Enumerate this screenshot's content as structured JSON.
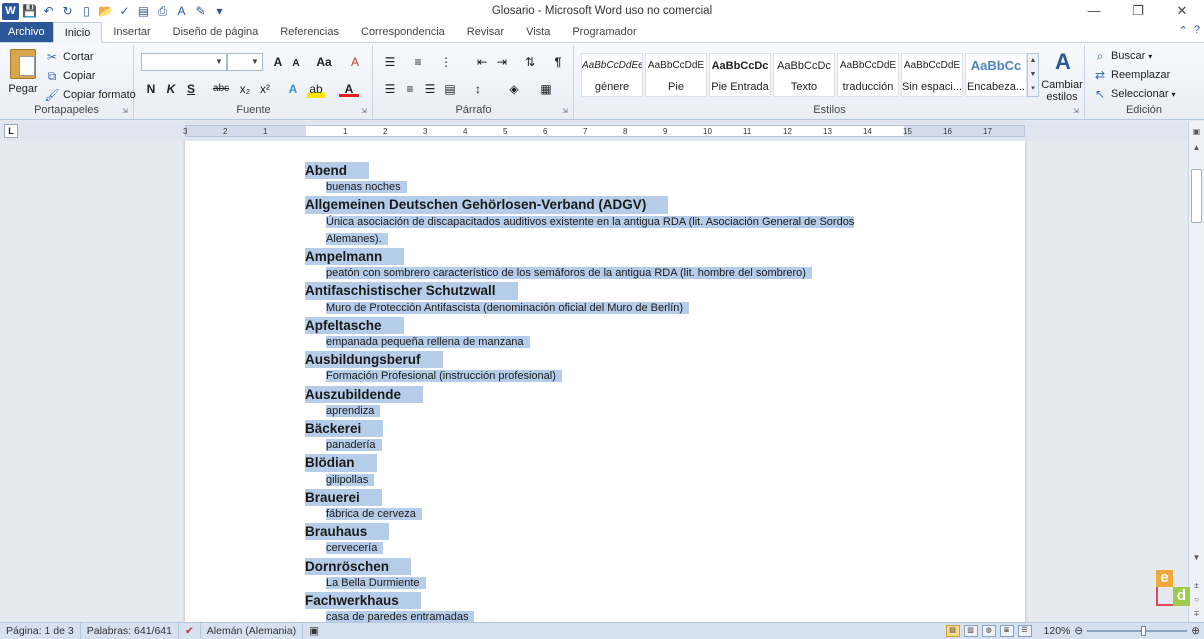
{
  "window": {
    "title": "Glosario  -  Microsoft Word uso no comercial",
    "app_icon_label": "W",
    "controls": [
      "—",
      "❐",
      "✕"
    ]
  },
  "qat": {
    "icons": [
      "save-icon",
      "undo-icon",
      "redo-icon",
      "new-icon",
      "open-icon",
      "spelling-icon",
      "print-preview-icon",
      "quick-print-icon",
      "font-color-icon",
      "track-icon",
      "customize-icon"
    ]
  },
  "tabs": [
    {
      "label": "Archivo",
      "kind": "file"
    },
    {
      "label": "Inicio",
      "kind": "active"
    },
    {
      "label": "Insertar"
    },
    {
      "label": "Diseño de página"
    },
    {
      "label": "Referencias"
    },
    {
      "label": "Correspondencia"
    },
    {
      "label": "Revisar"
    },
    {
      "label": "Vista"
    },
    {
      "label": "Programador"
    }
  ],
  "ribbon": {
    "clipboard": {
      "label": "Portapapeles",
      "paste": "Pegar",
      "cut": "Cortar",
      "copy": "Copiar",
      "format_painter": "Copiar formato"
    },
    "font": {
      "label": "Fuente",
      "name_value": "",
      "size_value": "",
      "bold": "N",
      "italic": "K",
      "underline": "S",
      "strike": "abc",
      "subscript": "x₂",
      "superscript": "x²",
      "grow": "A",
      "shrink": "A",
      "change_case": "Aa",
      "clear": "A",
      "effects": "A",
      "highlight": "ab",
      "font_color": "A"
    },
    "paragraph": {
      "label": "Párrafo"
    },
    "styles": {
      "label": "Estilos",
      "items": [
        {
          "preview": "AaBbCcDdEe",
          "name": "génere"
        },
        {
          "preview": "AaBbCcDdE",
          "name": "Pie"
        },
        {
          "preview": "AaBbCcDc",
          "name": "Pie Entrada"
        },
        {
          "preview": "AaBbCcDc",
          "name": "Texto"
        },
        {
          "preview": "AaBbCcDdE",
          "name": "traducción"
        },
        {
          "preview": "AaBbCcDdE",
          "name": "Sin espaci..."
        },
        {
          "preview": "AaBbCc",
          "name": "Encabeza..."
        }
      ],
      "change_styles": "Cambiar estilos"
    },
    "editing": {
      "label": "Edición",
      "find": "Buscar",
      "replace": "Reemplazar",
      "select": "Seleccionar"
    }
  },
  "ruler": {
    "ticks": [
      "3",
      "2",
      "1",
      "1",
      "2",
      "3",
      "4",
      "5",
      "6",
      "7",
      "8",
      "9",
      "10",
      "11",
      "12",
      "13",
      "14",
      "15",
      "16",
      "17"
    ]
  },
  "document": {
    "entries": [
      {
        "term": "Abend",
        "def": "buenas noches"
      },
      {
        "term": "Allgemeinen Deutschen Gehörlosen-Verband (ADGV)",
        "def": "Única asociación de discapacitados auditivos existente en la antigua RDA (lit. Asociación General de Sordos Alemanes)."
      },
      {
        "term": "Ampelmann",
        "def": "peatón con sombrero característico de los semáforos de la antigua RDA (lit. hombre del sombrero)"
      },
      {
        "term": "Antifaschistischer Schutzwall",
        "def": "Muro de Protección Antifascista (denominación oficial del Muro de Berlín)"
      },
      {
        "term": "Apfeltasche",
        "def": "empanada pequeña rellena de manzana"
      },
      {
        "term": "Ausbildungsberuf",
        "def": "Formación Profesional (instrucción profesional)"
      },
      {
        "term": "Auszubildende",
        "def": "aprendiza"
      },
      {
        "term": "Bäckerei",
        "def": "panadería"
      },
      {
        "term": "Blödian",
        "def": "gilipollas"
      },
      {
        "term": "Brauerei",
        "def": "fábrica de cerveza"
      },
      {
        "term": "Brauhaus",
        "def": "cervecería"
      },
      {
        "term": "Dornröschen",
        "def": "La Bella Durmiente"
      },
      {
        "term": "Fachwerkhaus",
        "def": "casa de paredes entramadas"
      }
    ]
  },
  "status": {
    "page": "Página: 1 de 3",
    "words": "Palabras: 641/641",
    "language": "Alemán (Alemania)",
    "zoom": "120%"
  },
  "logo": {
    "e": "e",
    "d": "d"
  }
}
